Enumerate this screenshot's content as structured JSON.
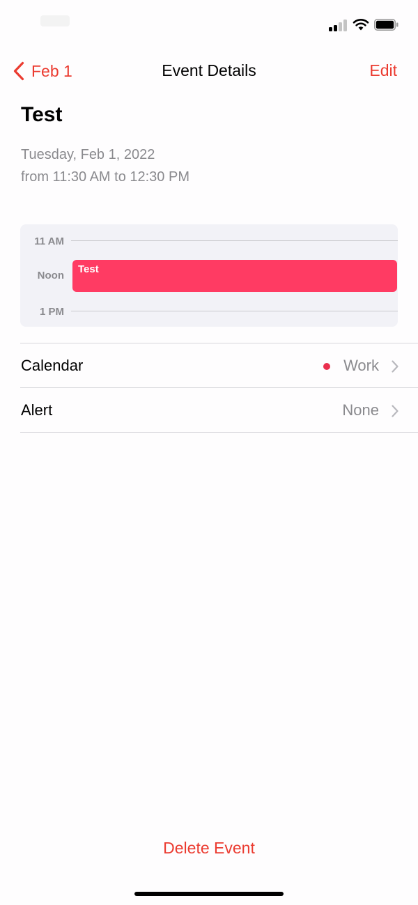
{
  "nav": {
    "back_label": "Feb 1",
    "title": "Event Details",
    "edit_label": "Edit"
  },
  "event": {
    "title": "Test",
    "date": "Tuesday, Feb 1, 2022",
    "time": "from 11:30 AM to 12:30 PM"
  },
  "timeline": {
    "labels": [
      "11 AM",
      "Noon",
      "1 PM"
    ],
    "event_label": "Test",
    "event_color": "#ff3b63"
  },
  "rows": [
    {
      "label": "Calendar",
      "value": "Work",
      "dot_color": "#ea2f4e"
    },
    {
      "label": "Alert",
      "value": "None"
    }
  ],
  "delete_label": "Delete Event",
  "colors": {
    "accent": "#eb3b30",
    "secondary_text": "#8a8a8e"
  },
  "status": {
    "icons": [
      "cellular-signal-icon",
      "wifi-icon",
      "battery-icon"
    ]
  }
}
